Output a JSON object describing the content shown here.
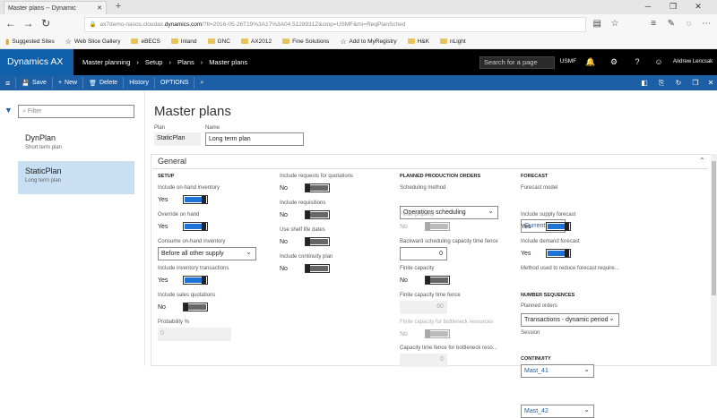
{
  "browser": {
    "tab_title": "Master plans -- Dynamic",
    "url_prefix": "ax7demo-nasos.cloudax.",
    "url_domain": "dynamics.com",
    "url_rest": "/?lt=2016-05-26T19%3A17%3A04.5128931Z&cmp=USMF&mi=ReqPlanSched",
    "favorites": [
      "Suggested Sites",
      "Web Slice Gallery",
      "eBECS",
      "Inland",
      "GNC",
      "AX2012",
      "Fine Solutions",
      "Add to MyRegistry",
      "H&K",
      "nLight"
    ]
  },
  "navbar": {
    "brand": "Dynamics AX",
    "crumbs": [
      "Master planning",
      "›",
      "Setup",
      "›",
      "Plans",
      "›",
      "Master plans"
    ],
    "search_placeholder": "Search for a page",
    "company": "USMF",
    "user": "Andrew Lencsak"
  },
  "actions": {
    "save": "Save",
    "new": "New",
    "delete": "Delete",
    "history": "History",
    "options": "OPTIONS"
  },
  "left": {
    "filter_placeholder": "Filter",
    "items": [
      {
        "name": "DynPlan",
        "desc": "Short term plan"
      },
      {
        "name": "StaticPlan",
        "desc": "Long term plan"
      }
    ]
  },
  "main": {
    "title": "Master plans",
    "plan_label": "Plan",
    "plan_value": "StaticPlan",
    "name_label": "Name",
    "name_value": "Long term plan",
    "section": "General"
  },
  "setup": {
    "header": "SETUP",
    "onhand_label": "Include on-hand inventory",
    "onhand_value": "Yes",
    "override_label": "Override on hand",
    "override_value": "Yes",
    "consume_label": "Consume on-hand inventory",
    "consume_value": "Before all other supply",
    "trans_label": "Include inventory transactions",
    "trans_value": "Yes",
    "quot_label": "Include sales quotations",
    "quot_value": "No",
    "prob_label": "Probability %",
    "prob_value": "0"
  },
  "col2": {
    "rfq_label": "Include requests for quotations",
    "rfq_value": "No",
    "req_label": "Include requisitions",
    "req_value": "No",
    "shelf_label": "Use shelf life dates",
    "shelf_value": "No",
    "cont_label": "Include continuity plan",
    "cont_value": "No"
  },
  "production": {
    "header": "PLANNED PRODUCTION ORDERS",
    "sched_label": "Scheduling method",
    "sched_value": "Operations scheduling",
    "finite_prop_label": "Finite property",
    "finite_prop_value": "No",
    "backward_label": "Backward scheduling capacity time fence",
    "backward_value": "0",
    "finite_cap_label": "Finite capacity",
    "finite_cap_value": "No",
    "fence_label": "Finite capacity time fence",
    "fence_value": "60",
    "bottleneck_label": "Finite capacity for bottleneck resources",
    "bottleneck_value": "No",
    "bfence_label": "Capacity time fence for bottleneck reso...",
    "bfence_value": "0"
  },
  "forecast": {
    "header": "FORECAST",
    "model_label": "Forecast model",
    "model_value": "CurrentF",
    "supply_label": "Include supply forecast",
    "supply_value": "Yes",
    "demand_label": "Include demand forecast",
    "demand_value": "Yes",
    "method_label": "Method used to reduce forecast require...",
    "method_value": "Transactions - dynamic period",
    "numseq_header": "NUMBER SEQUENCES",
    "planned_label": "Planned orders",
    "planned_value": "Mast_41",
    "session_label": "Session",
    "session_value": "Mast_42",
    "continuity_header": "CONTINUITY"
  }
}
